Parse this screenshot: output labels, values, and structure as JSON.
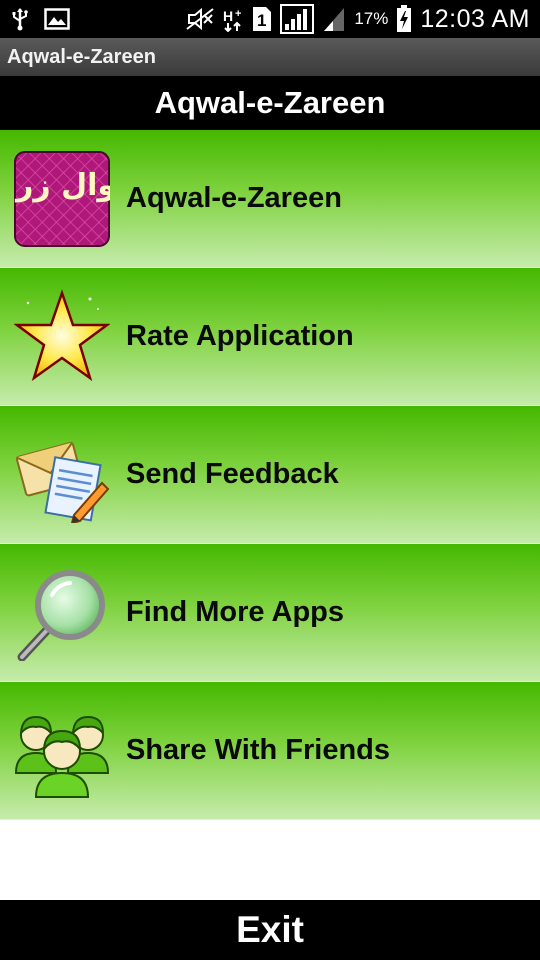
{
  "status_bar": {
    "battery_percent": "17%",
    "time": "12:03 AM",
    "signal_slot": "1",
    "icons": [
      "usb-icon",
      "image-icon",
      "mute-icon",
      "network-icon",
      "sim-icon",
      "signal-icon",
      "signal-weak-icon",
      "battery-icon"
    ]
  },
  "app": {
    "window_title": "Aqwal-e-Zareen",
    "header_title": "Aqwal-e-Zareen"
  },
  "menu": {
    "items": [
      {
        "label": "Aqwal-e-Zareen",
        "icon": "book-logo-icon"
      },
      {
        "label": "Rate Application",
        "icon": "star-icon"
      },
      {
        "label": "Send Feedback",
        "icon": "feedback-icon"
      },
      {
        "label": "Find More Apps",
        "icon": "magnifier-icon"
      },
      {
        "label": "Share With Friends",
        "icon": "users-icon"
      }
    ]
  },
  "footer": {
    "exit_label": "Exit"
  },
  "colors": {
    "green_top": "#45b800",
    "green_bottom": "#c6ebac",
    "bar": "#000000",
    "logo_bg": "#b0177a"
  },
  "logo_text": "اقوال زریں"
}
